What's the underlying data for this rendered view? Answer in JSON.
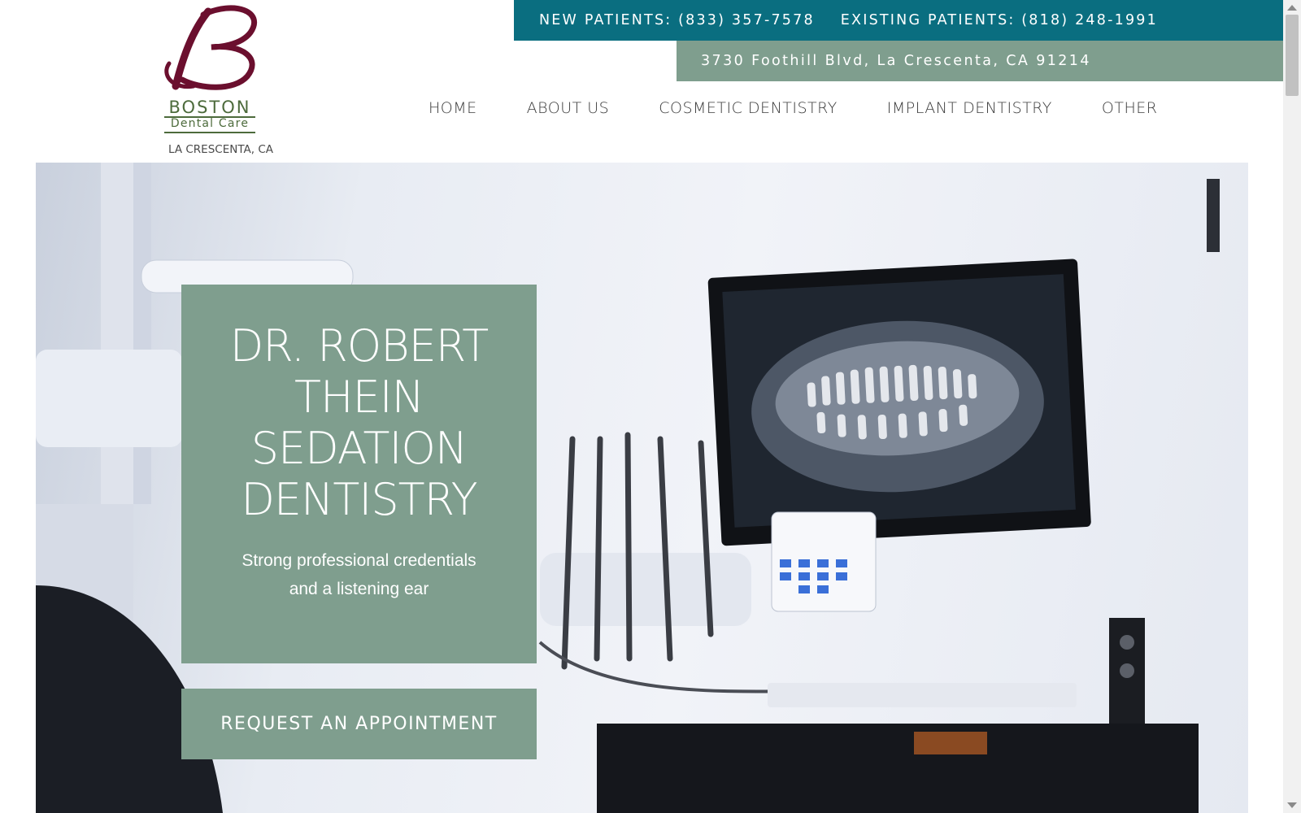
{
  "logo": {
    "brand": "BOSTON",
    "tagline": "Dental Care",
    "location": "LA CRESCENTA, CA",
    "colors": {
      "monogram": "#6b0f2e",
      "text": "#4d6b3c"
    }
  },
  "contact": {
    "new_patients": "NEW PATIENTS: (833) 357-7578",
    "existing_patients": "EXISTING PATIENTS: (818) 248-1991",
    "address": "3730 Foothill Blvd, La Crescenta, CA 91214"
  },
  "nav": {
    "items": [
      "HOME",
      "ABOUT US",
      "COSMETIC DENTISTRY",
      "IMPLANT DENTISTRY",
      "OTHER"
    ]
  },
  "hero": {
    "title_lines": [
      "DR. ROBERT",
      "THEIN",
      "SEDATION",
      "DENTISTRY"
    ],
    "subtitle_lines": [
      "Strong professional credentials",
      "and a listening ear"
    ],
    "cta_label": "REQUEST AN APPOINTMENT",
    "background_icon": "dental-office-photo-icon"
  },
  "colors": {
    "teal_bar": "#0a6e80",
    "sage": "#7f9e8e",
    "nav_text": "#3b3b3b"
  }
}
